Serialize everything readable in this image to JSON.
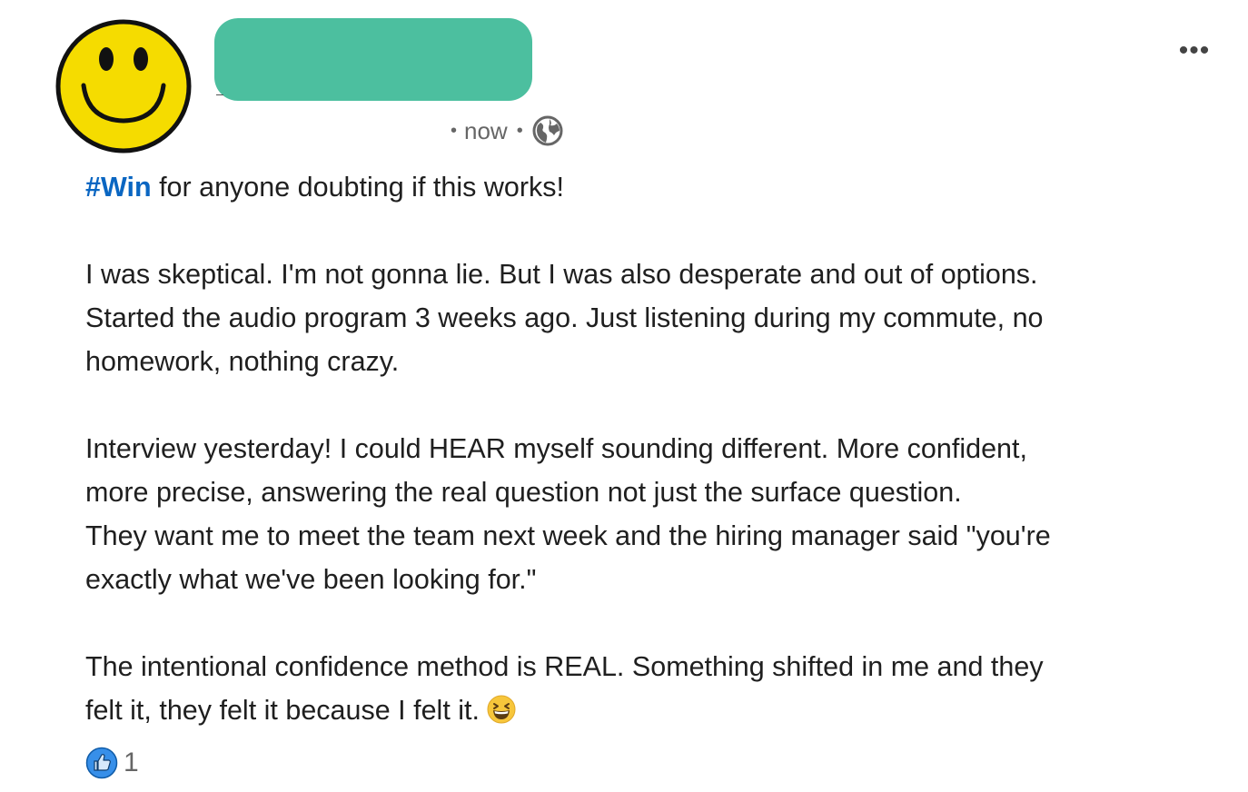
{
  "post": {
    "author_name": "",
    "timestamp": "now",
    "separator": "•",
    "visibility_icon": "globe-icon",
    "more_label": "•••",
    "hashtag": "#Win",
    "first_line_rest": " for anyone doubting if this works!",
    "paragraph_2_line_1": "I was skeptical. I'm not gonna lie. But I was also desperate and out of options.",
    "paragraph_2_line_2": "Started the audio program 3 weeks ago. Just listening during my commute, no",
    "paragraph_2_line_3": "homework, nothing crazy.",
    "paragraph_3_line_1": "Interview yesterday! I could HEAR myself sounding different. More confident,",
    "paragraph_3_line_2": "more precise, answering the real question not just the surface question.",
    "paragraph_3_line_3": "They want me to meet the team next week and the hiring manager said \"you're",
    "paragraph_3_line_4": "exactly what we've been looking for.\"",
    "paragraph_4_line_1": "The intentional confidence method is REAL. Something shifted in me and they",
    "paragraph_4_line_2": "felt it, they felt it because I felt it.",
    "emoji": "grinning-squinting-face-emoji",
    "reaction_icon": "like-icon",
    "reaction_count": "1"
  },
  "colors": {
    "hashtag": "#0a66c2",
    "redaction": "#4cbf9f",
    "avatar_face": "#f5dc00",
    "like_blue": "#378fe9"
  }
}
